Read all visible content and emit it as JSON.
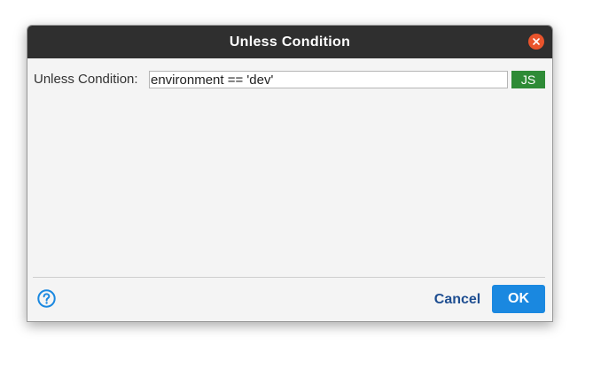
{
  "dialog": {
    "title": "Unless Condition",
    "close_icon": "close-icon",
    "colors": {
      "titlebar_bg": "#2f2f2f",
      "close_button": "#e9542c",
      "js_button": "#2e8b36",
      "ok_button": "#1a88e0",
      "cancel_text": "#1e4e91",
      "help_icon": "#1a88e0"
    }
  },
  "form": {
    "label": "Unless Condition:",
    "input_value": "environment == 'dev'",
    "js_button_label": "JS"
  },
  "footer": {
    "help_icon": "help-icon",
    "cancel_label": "Cancel",
    "ok_label": "OK"
  }
}
